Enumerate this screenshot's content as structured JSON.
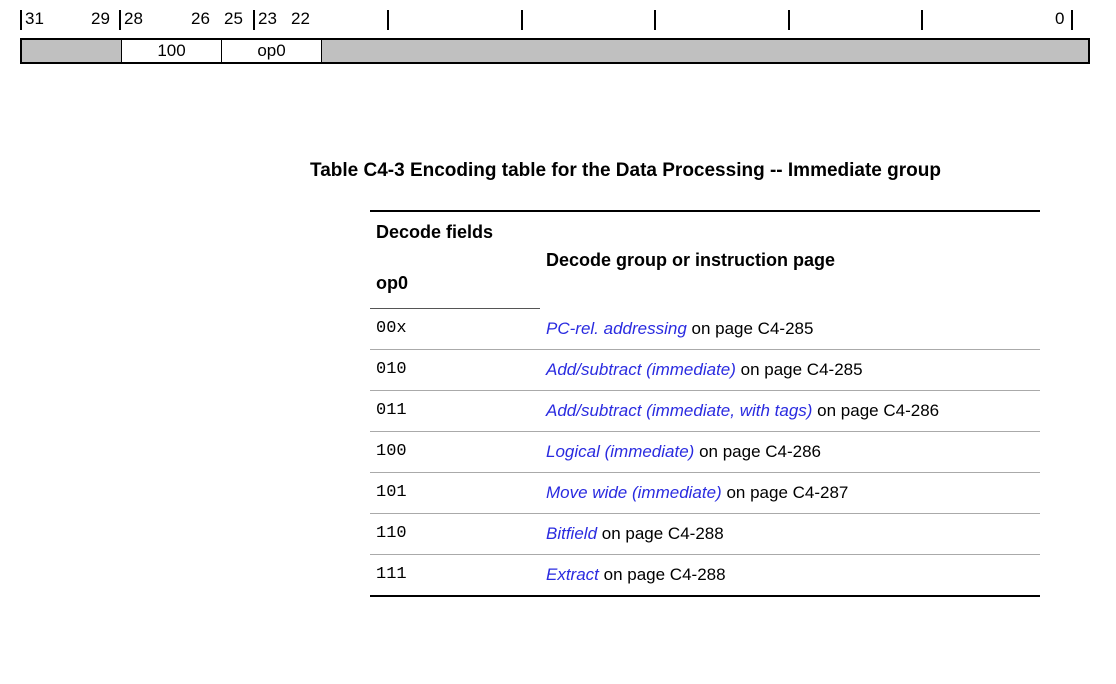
{
  "bitfield": {
    "labels": {
      "n31": "31",
      "n29": "29",
      "n28": "28",
      "n26": "26",
      "n25": "25",
      "n23": "23",
      "n22": "22",
      "n0": "0"
    },
    "cells": {
      "c1": "",
      "c2": "100",
      "c3": "op0",
      "c4": ""
    }
  },
  "table": {
    "caption": "Table C4-3 Encoding table for the Data Processing -- Immediate group",
    "headers": {
      "decode_fields": "Decode fields",
      "decode_group": "Decode group or instruction page",
      "op0": "op0"
    },
    "rows": [
      {
        "op0": "00x",
        "link": "PC-rel. addressing",
        "page": " on page C4-285"
      },
      {
        "op0": "010",
        "link": "Add/subtract (immediate)",
        "page": " on page C4-285"
      },
      {
        "op0": "011",
        "link": "Add/subtract (immediate, with tags)",
        "page": " on page C4-286"
      },
      {
        "op0": "100",
        "link": "Logical (immediate)",
        "page": " on page C4-286"
      },
      {
        "op0": "101",
        "link": "Move wide (immediate)",
        "page": " on page C4-287"
      },
      {
        "op0": "110",
        "link": "Bitfield",
        "page": " on page C4-288"
      },
      {
        "op0": "111",
        "link": "Extract",
        "page": " on page C4-288"
      }
    ]
  }
}
